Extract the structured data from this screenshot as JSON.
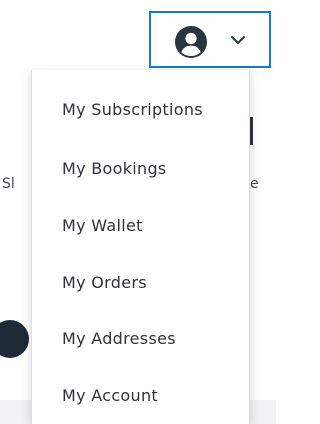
{
  "background": {
    "left_fragment": "Sl",
    "right_fragment": "e"
  },
  "account_button": {
    "avatar_icon": "user-avatar-icon",
    "chevron_icon": "chevron-down-icon",
    "border_color": "#1976d2"
  },
  "menu": {
    "items": [
      {
        "label": "My Subscriptions"
      },
      {
        "label": "My Bookings"
      },
      {
        "label": "My Wallet"
      },
      {
        "label": "My Orders"
      },
      {
        "label": "My Addresses"
      },
      {
        "label": "My Account"
      }
    ]
  }
}
